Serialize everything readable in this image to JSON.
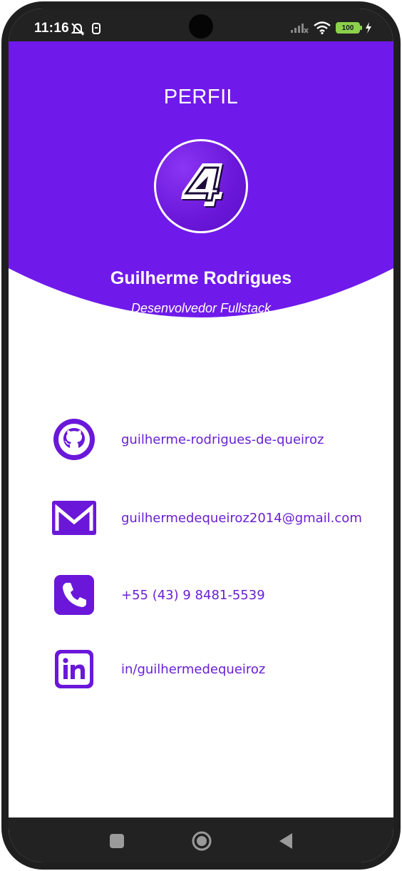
{
  "status": {
    "time": "11:16",
    "battery": "100"
  },
  "header": {
    "title": "PERFIL",
    "avatar_icon": "number-four-logo-icon",
    "name": "Guilherme Rodrigues",
    "role": "Desenvolvedor Fullstack",
    "color": "#6f1aeb"
  },
  "contacts": [
    {
      "icon": "github-icon",
      "label": "guilherme-rodrigues-de-queiroz"
    },
    {
      "icon": "email-icon",
      "label": "guilhermedequeiroz2014@gmail.com"
    },
    {
      "icon": "phone-icon",
      "label": "+55 (43) 9 8481-5539"
    },
    {
      "icon": "linkedin-icon",
      "label": "in/guilhermedequeiroz"
    }
  ],
  "navigation": {
    "buttons": [
      "recents-icon",
      "home-icon",
      "back-icon"
    ]
  },
  "colors": {
    "accent": "#6f1aeb",
    "icon": "#6a17d9",
    "text": "#6a1fd3"
  }
}
